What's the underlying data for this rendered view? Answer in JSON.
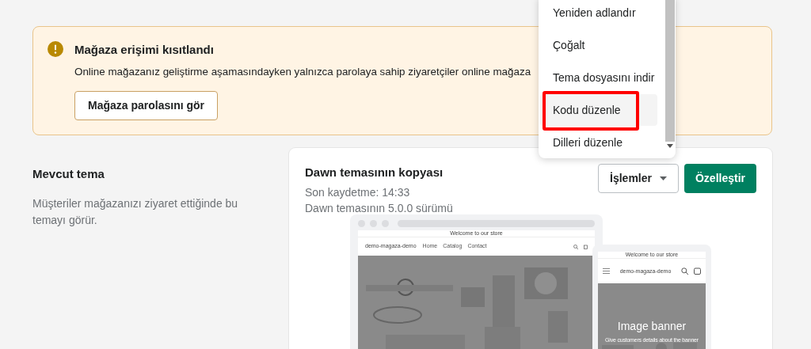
{
  "alert": {
    "title": "Mağaza erişimi kısıtlandı",
    "text": "Online mağazanız geliştirme aşamasındayken yalnızca parolaya sahip ziyaretçiler online mağaza",
    "button": "Mağaza parolasını gör"
  },
  "section": {
    "title": "Mevcut tema",
    "description": "Müşteriler mağazanızı ziyaret ettiğinde bu temayı görür."
  },
  "theme": {
    "name": "Dawn temasının kopyası",
    "saved": "Son kaydetme: 14:33",
    "version": "Dawn temasının 5.0.0 sürümü",
    "actions_button": "İşlemler",
    "customize_button": "Özelleştir"
  },
  "preview": {
    "desktop": {
      "announcement": "Welcome to our store",
      "store_name": "demo-magaza-demo",
      "nav": [
        "Home",
        "Catalog",
        "Contact"
      ]
    },
    "mobile": {
      "announcement": "Welcome to our store",
      "store_name": "demo-magaza-demo",
      "banner_title": "Image banner",
      "banner_text": "Give customers details about the banner"
    }
  },
  "menu": {
    "items": [
      {
        "label": "Yeniden adlandır",
        "selected": false,
        "highlighted": false
      },
      {
        "label": "Çoğalt",
        "selected": false,
        "highlighted": false
      },
      {
        "label": "Tema dosyasını indir",
        "selected": false,
        "highlighted": false
      },
      {
        "label": "Kodu düzenle",
        "selected": true,
        "highlighted": true
      },
      {
        "label": "Dilleri düzenle",
        "selected": false,
        "highlighted": false
      }
    ]
  }
}
